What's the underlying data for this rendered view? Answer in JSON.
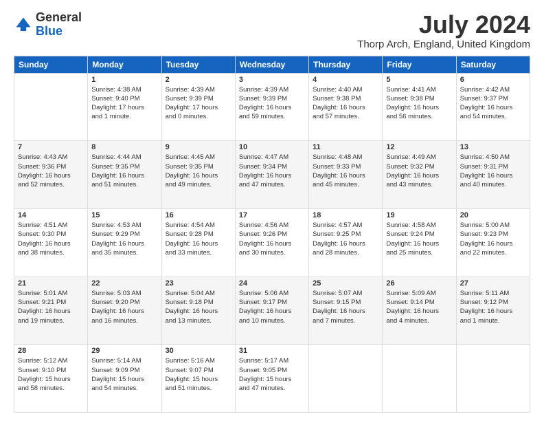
{
  "logo": {
    "general": "General",
    "blue": "Blue"
  },
  "title": "July 2024",
  "location": "Thorp Arch, England, United Kingdom",
  "weekdays": [
    "Sunday",
    "Monday",
    "Tuesday",
    "Wednesday",
    "Thursday",
    "Friday",
    "Saturday"
  ],
  "weeks": [
    [
      {
        "day": "",
        "info": ""
      },
      {
        "day": "1",
        "info": "Sunrise: 4:38 AM\nSunset: 9:40 PM\nDaylight: 17 hours\nand 1 minute."
      },
      {
        "day": "2",
        "info": "Sunrise: 4:39 AM\nSunset: 9:39 PM\nDaylight: 17 hours\nand 0 minutes."
      },
      {
        "day": "3",
        "info": "Sunrise: 4:39 AM\nSunset: 9:39 PM\nDaylight: 16 hours\nand 59 minutes."
      },
      {
        "day": "4",
        "info": "Sunrise: 4:40 AM\nSunset: 9:38 PM\nDaylight: 16 hours\nand 57 minutes."
      },
      {
        "day": "5",
        "info": "Sunrise: 4:41 AM\nSunset: 9:38 PM\nDaylight: 16 hours\nand 56 minutes."
      },
      {
        "day": "6",
        "info": "Sunrise: 4:42 AM\nSunset: 9:37 PM\nDaylight: 16 hours\nand 54 minutes."
      }
    ],
    [
      {
        "day": "7",
        "info": "Sunrise: 4:43 AM\nSunset: 9:36 PM\nDaylight: 16 hours\nand 52 minutes."
      },
      {
        "day": "8",
        "info": "Sunrise: 4:44 AM\nSunset: 9:35 PM\nDaylight: 16 hours\nand 51 minutes."
      },
      {
        "day": "9",
        "info": "Sunrise: 4:45 AM\nSunset: 9:35 PM\nDaylight: 16 hours\nand 49 minutes."
      },
      {
        "day": "10",
        "info": "Sunrise: 4:47 AM\nSunset: 9:34 PM\nDaylight: 16 hours\nand 47 minutes."
      },
      {
        "day": "11",
        "info": "Sunrise: 4:48 AM\nSunset: 9:33 PM\nDaylight: 16 hours\nand 45 minutes."
      },
      {
        "day": "12",
        "info": "Sunrise: 4:49 AM\nSunset: 9:32 PM\nDaylight: 16 hours\nand 43 minutes."
      },
      {
        "day": "13",
        "info": "Sunrise: 4:50 AM\nSunset: 9:31 PM\nDaylight: 16 hours\nand 40 minutes."
      }
    ],
    [
      {
        "day": "14",
        "info": "Sunrise: 4:51 AM\nSunset: 9:30 PM\nDaylight: 16 hours\nand 38 minutes."
      },
      {
        "day": "15",
        "info": "Sunrise: 4:53 AM\nSunset: 9:29 PM\nDaylight: 16 hours\nand 35 minutes."
      },
      {
        "day": "16",
        "info": "Sunrise: 4:54 AM\nSunset: 9:28 PM\nDaylight: 16 hours\nand 33 minutes."
      },
      {
        "day": "17",
        "info": "Sunrise: 4:56 AM\nSunset: 9:26 PM\nDaylight: 16 hours\nand 30 minutes."
      },
      {
        "day": "18",
        "info": "Sunrise: 4:57 AM\nSunset: 9:25 PM\nDaylight: 16 hours\nand 28 minutes."
      },
      {
        "day": "19",
        "info": "Sunrise: 4:58 AM\nSunset: 9:24 PM\nDaylight: 16 hours\nand 25 minutes."
      },
      {
        "day": "20",
        "info": "Sunrise: 5:00 AM\nSunset: 9:23 PM\nDaylight: 16 hours\nand 22 minutes."
      }
    ],
    [
      {
        "day": "21",
        "info": "Sunrise: 5:01 AM\nSunset: 9:21 PM\nDaylight: 16 hours\nand 19 minutes."
      },
      {
        "day": "22",
        "info": "Sunrise: 5:03 AM\nSunset: 9:20 PM\nDaylight: 16 hours\nand 16 minutes."
      },
      {
        "day": "23",
        "info": "Sunrise: 5:04 AM\nSunset: 9:18 PM\nDaylight: 16 hours\nand 13 minutes."
      },
      {
        "day": "24",
        "info": "Sunrise: 5:06 AM\nSunset: 9:17 PM\nDaylight: 16 hours\nand 10 minutes."
      },
      {
        "day": "25",
        "info": "Sunrise: 5:07 AM\nSunset: 9:15 PM\nDaylight: 16 hours\nand 7 minutes."
      },
      {
        "day": "26",
        "info": "Sunrise: 5:09 AM\nSunset: 9:14 PM\nDaylight: 16 hours\nand 4 minutes."
      },
      {
        "day": "27",
        "info": "Sunrise: 5:11 AM\nSunset: 9:12 PM\nDaylight: 16 hours\nand 1 minute."
      }
    ],
    [
      {
        "day": "28",
        "info": "Sunrise: 5:12 AM\nSunset: 9:10 PM\nDaylight: 15 hours\nand 58 minutes."
      },
      {
        "day": "29",
        "info": "Sunrise: 5:14 AM\nSunset: 9:09 PM\nDaylight: 15 hours\nand 54 minutes."
      },
      {
        "day": "30",
        "info": "Sunrise: 5:16 AM\nSunset: 9:07 PM\nDaylight: 15 hours\nand 51 minutes."
      },
      {
        "day": "31",
        "info": "Sunrise: 5:17 AM\nSunset: 9:05 PM\nDaylight: 15 hours\nand 47 minutes."
      },
      {
        "day": "",
        "info": ""
      },
      {
        "day": "",
        "info": ""
      },
      {
        "day": "",
        "info": ""
      }
    ]
  ]
}
